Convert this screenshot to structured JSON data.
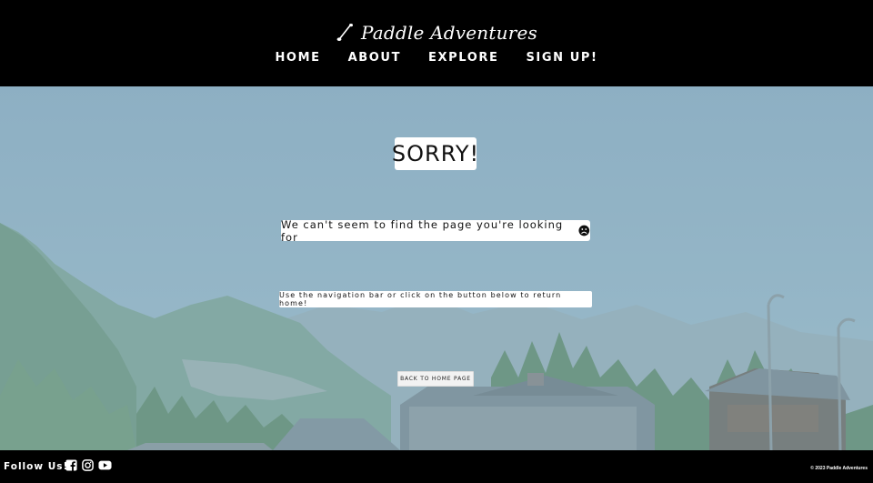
{
  "header": {
    "brand_name": "Paddle Adventures",
    "brand_icon": "paddle-icon",
    "nav": [
      {
        "label": "HOME"
      },
      {
        "label": "ABOUT"
      },
      {
        "label": "EXPLORE"
      },
      {
        "label": "SIGN UP!"
      }
    ]
  },
  "main": {
    "title": "SORRY!",
    "message": "We can't seem to find the page you're looking for",
    "message_icon": "sad-face-icon",
    "subtext": "Use the navigation bar or click on the button below to return home!",
    "button_label": "BACK TO HOME PAGE",
    "background": "mountain-village-landscape"
  },
  "footer": {
    "follow_label": "Follow Us!",
    "socials": [
      "facebook-icon",
      "instagram-icon",
      "youtube-icon"
    ],
    "copyright": "© 2023 Paddle Adventures"
  },
  "colors": {
    "header_bg": "#000000",
    "footer_bg": "#000000",
    "box_bg": "#ffffff",
    "text": "#111111"
  }
}
